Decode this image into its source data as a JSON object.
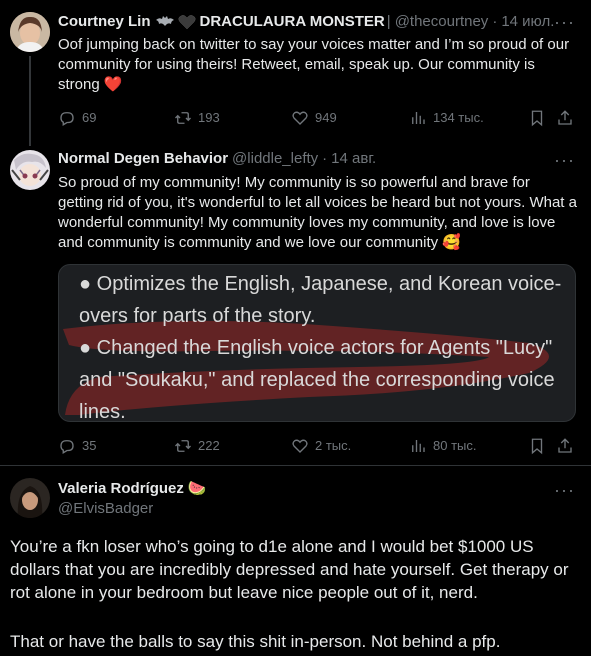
{
  "tweets": [
    {
      "name": "Courtney Lin",
      "name_suffix": "DRACULAURA MONSTER",
      "handle": "@thecourtney",
      "date": "14 июл.",
      "text": "Oof jumping back on twitter to say your voices matter and I’m so proud of our community for using theirs! Retweet, email, speak up. Our community is strong",
      "emoji": "❤️",
      "replies": "69",
      "retweets": "193",
      "likes": "949",
      "views": "134 тыс."
    },
    {
      "name": "Normal Degen Behavior",
      "handle": "@liddle_lefty",
      "date": "14 авг.",
      "text": "So proud of my community! My community is so powerful and brave for getting rid of you, it's wonderful to let all voices be heard but not yours. What a wonderful community! My community loves my community, and love is love and community is community and we love our community",
      "emoji": "🥰",
      "media_lines": [
        "● Optimizes the English, Japanese, and Korean voice-overs for parts of the story.",
        "● Changed the English voice actors for Agents \"Lucy\" and \"Soukaku,\" and replaced the corresponding voice lines."
      ],
      "replies": "35",
      "retweets": "222",
      "likes": "2 тыс.",
      "views": "80 тыс."
    },
    {
      "name": "Valeria Rodríguez",
      "emoji": "🍉",
      "handle": "@ElvisBadger",
      "paragraph1": "You’re a fkn loser who’s going to d1e alone and I would bet $1000 US dollars that you are incredibly depressed and hate yourself. Get therapy or rot alone in your bedroom but leave nice people out of it, nerd.",
      "paragraph2": "That or have the balls to say this shit in-person. Not behind a pfp."
    }
  ],
  "colors": {
    "background": "#000000",
    "text": "#e7e9ea",
    "muted": "#71767b",
    "border": "#2f3336",
    "heart": "#f91880"
  },
  "icons": [
    "reply-icon",
    "retweet-icon",
    "like-icon",
    "views-icon",
    "bookmark-icon",
    "share-icon",
    "more-icon",
    "bat-icon",
    "heart-icon"
  ]
}
